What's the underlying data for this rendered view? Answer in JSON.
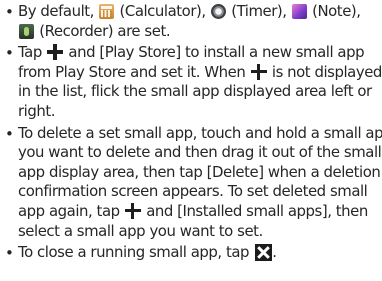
{
  "bullet_glyph": "•",
  "notes": [
    {
      "segments": {
        "s1": "By default, ",
        "s2": " (Calculator), ",
        "s3": " (Timer), ",
        "s4": " (Note),",
        "s5": " (Recorder) are set."
      },
      "icons": [
        "calculator-icon",
        "timer-icon",
        "note-icon",
        "recorder-icon"
      ]
    },
    {
      "segments": {
        "s1": "Tap ",
        "s2": " and [Play Store] to install a new small app",
        "s3": "from Play Store and set it. When ",
        "s4": " is not displayed",
        "s5": "in the list, flick the small app displayed area left or",
        "s6": "right."
      },
      "icons": [
        "plus-icon",
        "plus-icon"
      ]
    },
    {
      "segments": {
        "l1": "To delete a set small app, touch and hold a small app",
        "l2": "you want to delete and then drag it out of the small",
        "l3": "app display area, then tap [Delete] when a deletion",
        "l4": "confirmation screen appears. To set deleted small",
        "l5a": "app again, tap ",
        "l5b": " and [Installed small apps], then",
        "l6": "select a small app you want to set."
      },
      "icons": [
        "plus-icon"
      ]
    },
    {
      "segments": {
        "s1": "To close a running small app, tap ",
        "s2": "."
      },
      "icons": [
        "close-icon"
      ]
    }
  ]
}
